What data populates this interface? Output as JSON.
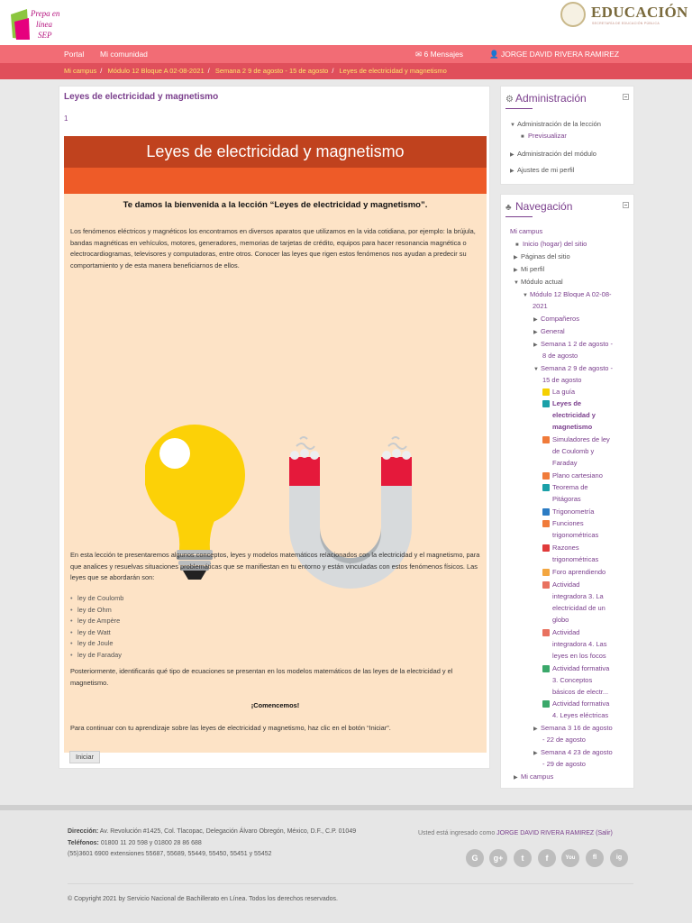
{
  "header": {
    "logo_left_text": "Prepa en línea SEP",
    "logo_right_title": "EDUCACIÓN",
    "logo_right_sub": "SECRETARÍA DE EDUCACIÓN PÚBLICA"
  },
  "nav": {
    "portal": "Portal",
    "community": "Mi comunidad",
    "messages": "6 Mensajes",
    "user": "JORGE DAVID RIVERA RAMIREZ"
  },
  "breadcrumb": [
    "Mi campus",
    "Módulo 12 Bloque A 02-08-2021",
    "Semana 2 9 de agosto - 15 de agosto",
    "Leyes de electricidad y magnetismo"
  ],
  "main": {
    "title": "Leyes de electricidad y magnetismo",
    "page_number": "1",
    "banner": "Leyes de electricidad y magnetismo",
    "welcome": "Te damos la bienvenida a la lección “Leyes de electricidad y magnetismo”.",
    "para1": "Los fenómenos eléctricos y magnéticos los encontramos en diversos aparatos que utilizamos en la vida cotidiana, por ejemplo: la brújula, bandas magnéticas en vehículos, motores, generadores, memorias de tarjetas de crédito, equipos para hacer resonancia magnética o electrocardiogramas, televisores y computadoras, entre otros. Conocer las leyes que rigen estos fenómenos nos ayudan a predecir su comportamiento y de esta manera beneficiarnos de ellos.",
    "para2": "En esta lección te presentaremos algunos conceptos, leyes y modelos matemáticos relacionados con la electricidad y el magnetismo, para que analices y resuelvas situaciones problemáticas que se manifiestan en tu entorno y están vinculadas con estos fenómenos físicos. Las leyes que se abordarán son:",
    "laws": [
      "ley de Coulomb",
      "ley de Ohm",
      "ley de Ampère",
      "ley de Watt",
      "ley de Joule",
      "ley de Faraday"
    ],
    "para3": "Posteriormente, identificarás qué tipo de ecuaciones se presentan en los modelos matemáticos de las leyes de la electricidad y el magnetismo.",
    "lets_start": "¡Comencemos!",
    "para4": "Para continuar con tu aprendizaje sobre las leyes de electricidad y magnetismo, haz clic en el botón “Iniciar”.",
    "start_button": "Iniciar"
  },
  "admin_block": {
    "title": "Administración",
    "items": [
      "Administración de la lección",
      "Previsualizar",
      "Administración del módulo",
      "Ajustes de mi perfil"
    ]
  },
  "nav_block": {
    "title": "Navegación",
    "my_campus": "Mi campus",
    "home": "Inicio (hogar) del sitio",
    "site_pages": "Páginas del sitio",
    "my_profile": "Mi perfil",
    "current_module": "Módulo actual",
    "module_line1": "Módulo 12 Bloque A 02-08-",
    "module_line2": "2021",
    "companions": "Compañeros",
    "general": "General",
    "week1_l1": "Semana 1 2 de agosto -",
    "week1_l2": "8 de agosto",
    "week2_l1": "Semana 2 9 de agosto -",
    "week2_l2": "15 de agosto",
    "a_guide": "La guía",
    "a_lesson_l1": "Leyes de",
    "a_lesson_l2": "electricidad y",
    "a_lesson_l3": "magnetismo",
    "a_sim_l1": "Simuladores de ley",
    "a_sim_l2": "de Coulomb y",
    "a_sim_l3": "Faraday",
    "a_plane": "Plano cartesiano",
    "a_pyth_l1": "Teorema de",
    "a_pyth_l2": "Pitágoras",
    "a_trig": "Trigonometría",
    "a_func_l1": "Funciones",
    "a_func_l2": "trigonométricas",
    "a_ratio_l1": "Razones",
    "a_ratio_l2": "trigonométricas",
    "a_forum": "Foro aprendiendo",
    "a_act3_l1": "Actividad",
    "a_act3_l2": "integradora 3. La",
    "a_act3_l3": "electricidad de un",
    "a_act3_l4": "globo",
    "a_act4_l1": "Actividad",
    "a_act4_l2": "integradora 4. Las",
    "a_act4_l3": "leyes en los focos",
    "a_form3_l1": "Actividad formativa",
    "a_form3_l2": "3. Conceptos",
    "a_form3_l3": "básicos de electr...",
    "a_form4_l1": "Actividad formativa",
    "a_form4_l2": "4. Leyes eléctricas",
    "week3_l1": "Semana 3 16 de agosto",
    "week3_l2": "- 22 de agosto",
    "week4_l1": "Semana 4 23 de agosto",
    "week4_l2": "- 29 de agosto",
    "my_campus2": "Mi campus"
  },
  "footer": {
    "address_label": "Dirección:",
    "address": "Av. Revolución #1425, Col. Tlacopac, Delegación Álvaro Obregón,      México, D.F., C.P. 01049",
    "phones_label": "Teléfonos:",
    "phones": "01800 11 20 598 y 01800 28 86 688",
    "phones2": "(55)3601 6900 extensiones 55687, 55689, 55449, 55450, 55451 y 55452",
    "logged_prefix": "Usted está ingresado como",
    "logged_user": "JORGE DAVID RIVERA RAMIREZ (Salir)",
    "social": [
      "G",
      "g+",
      "t",
      "f",
      "You",
      "fl",
      "ig"
    ],
    "copyright": "© Copyright 2021 by Servicio Nacional de Bachillerato en Línea. Todos los derechos reservados."
  },
  "colors": {
    "nav": "#f26c75",
    "breadcrumb": "#e04f5b",
    "banner": "#c0421e",
    "accent": "#7a3e8c",
    "content_bg": "#fde3c6"
  }
}
